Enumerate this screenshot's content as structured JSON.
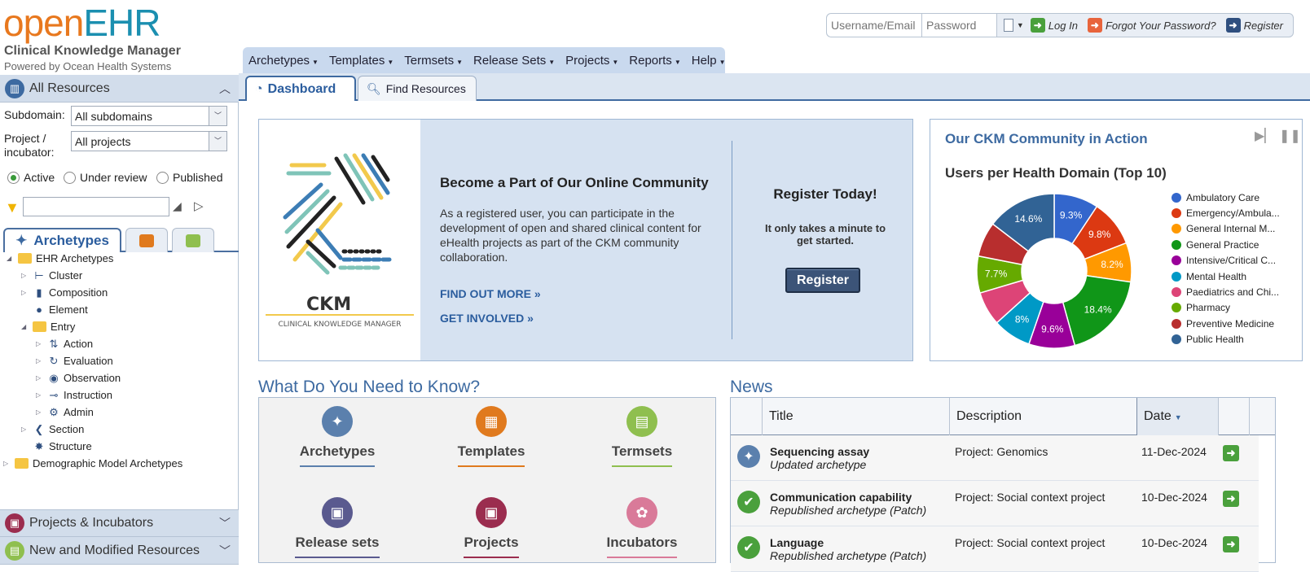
{
  "header": {
    "logo_part1": "open",
    "logo_part2": "EHR",
    "app_title": "Clinical Knowledge Manager",
    "powered_by": "Powered by Ocean Health Systems"
  },
  "login": {
    "username_placeholder": "Username/Email",
    "password_placeholder": "Password",
    "login_label": "Log In",
    "forgot_label": "Forgot Your Password?",
    "register_label": "Register"
  },
  "menu": [
    "Archetypes",
    "Templates",
    "Termsets",
    "Release Sets",
    "Projects",
    "Reports",
    "Help"
  ],
  "sidebar": {
    "all_resources": "All Resources",
    "subdomain_label": "Subdomain:",
    "subdomain_value": "All subdomains",
    "project_label_1": "Project /",
    "project_label_2": "incubator:",
    "project_value": "All projects",
    "status_options": [
      "Active",
      "Under review",
      "Published"
    ],
    "active_tab": "Archetypes",
    "tree": {
      "root": "EHR Archetypes",
      "cluster": "Cluster",
      "composition": "Composition",
      "element": "Element",
      "entry": "Entry",
      "action": "Action",
      "evaluation": "Evaluation",
      "observation": "Observation",
      "instruction": "Instruction",
      "admin": "Admin",
      "section": "Section",
      "structure": "Structure",
      "demographic": "Demographic Model Archetypes"
    },
    "projects_panel": "Projects & Incubators",
    "new_modified_panel": "New and Modified Resources"
  },
  "main_tabs": {
    "dashboard": "Dashboard",
    "find": "Find Resources"
  },
  "banner": {
    "logo_text": "CKM",
    "logo_subtext": "CLINICAL KNOWLEDGE MANAGER",
    "heading": "Become a Part of Our Online Community",
    "body": "As a registered user, you can participate in the development of open and shared clinical content for eHealth projects as part of the CKM community collaboration.",
    "find_out": "FIND OUT MORE »",
    "get_involved": "GET INVOLVED »",
    "register_heading": "Register Today!",
    "register_sub": "It only takes a minute to get started.",
    "register_button": "Register"
  },
  "community": {
    "title": "Our CKM Community in Action",
    "subtitle": "Users per Health Domain (Top 10)"
  },
  "chart_data": {
    "type": "pie",
    "title": "Users per Health Domain (Top 10)",
    "legend_position": "right",
    "categories": [
      "Ambulatory Care",
      "Emergency/Ambula...",
      "General Internal M...",
      "General Practice",
      "Intensive/Critical C...",
      "Mental Health",
      "Paediatrics and Chi...",
      "Pharmacy",
      "Preventive Medicine",
      "Public Health"
    ],
    "values": [
      9.3,
      9.8,
      8.2,
      18.4,
      9.6,
      8.0,
      7.1,
      7.7,
      7.3,
      14.6
    ],
    "labels": [
      "9.3%",
      "9.8%",
      "8.2%",
      "18.4%",
      "9.6%",
      "8%",
      "",
      "7.7%",
      "",
      "14.6%"
    ],
    "colors": [
      "#3366cc",
      "#dc3912",
      "#ff9900",
      "#109618",
      "#990099",
      "#0099c6",
      "#dd4477",
      "#66aa00",
      "#b82e2e",
      "#316395"
    ]
  },
  "know": {
    "title": "What Do You Need to Know?",
    "items": [
      "Archetypes",
      "Templates",
      "Termsets",
      "Release sets",
      "Projects",
      "Incubators"
    ]
  },
  "news": {
    "title": "News",
    "columns": [
      "Title",
      "Description",
      "Date"
    ],
    "rows": [
      {
        "title": "Sequencing assay",
        "subtitle": "Updated archetype",
        "description": "Project: Genomics",
        "date": "11-Dec-2024"
      },
      {
        "title": "Communication capability",
        "subtitle": "Republished archetype (Patch)",
        "description": "Project: Social context project",
        "date": "10-Dec-2024"
      },
      {
        "title": "Language",
        "subtitle": "Republished archetype (Patch)",
        "description": "Project: Social context project",
        "date": "10-Dec-2024"
      }
    ]
  }
}
